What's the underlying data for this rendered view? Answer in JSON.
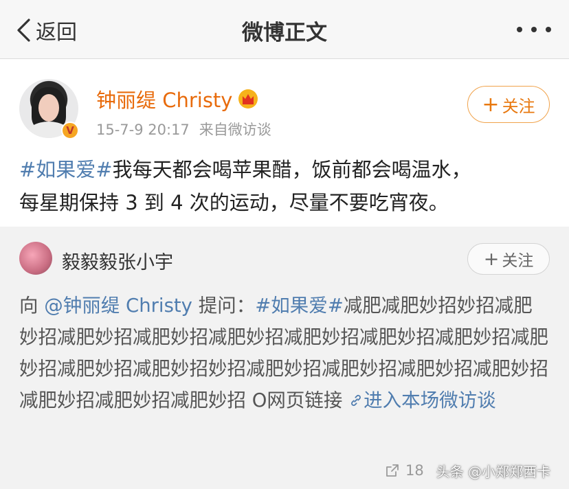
{
  "nav": {
    "back_label": "返回",
    "title": "微博正文"
  },
  "post": {
    "author": "钟丽缇 Christy",
    "time": "15-7-9 20:17",
    "source": "来自微访谈",
    "follow_label": "关注",
    "hashtag": "#如果爱#",
    "text_line1": "我每天都会喝苹果醋，饭前都会喝温水，",
    "text_line2": "每星期保持 3 到 4 次的运动，尽量不要吃宵夜。"
  },
  "quoted": {
    "asker": "毅毅毅张小宇",
    "follow_label": "关注",
    "prefix": "向",
    "mention": "@钟丽缇 Christy",
    "ask_word": "提问：",
    "hashtag": "#如果爱#",
    "question": "减肥减肥妙招妙招减肥妙招减肥妙招减肥妙招减肥妙招减肥妙招减肥妙招减肥妙招减肥妙招减肥妙招减肥妙招妙招减肥妙招减肥妙招减肥妙招减肥妙招减肥妙招减肥妙招减肥妙招",
    "web_link": "O网页链接",
    "interview_link": "进入本场微访谈",
    "share_count": "18",
    "watermark": "头条 @小郑郑西卡"
  },
  "colors": {
    "author_orange": "#e86b0c",
    "link_blue": "#507daf",
    "follow_orange": "#f0a24a"
  },
  "icons": [
    "chevron-left-icon",
    "more-dots-icon",
    "crown-icon",
    "verified-v-icon",
    "plus-icon",
    "link-icon",
    "share-icon"
  ]
}
